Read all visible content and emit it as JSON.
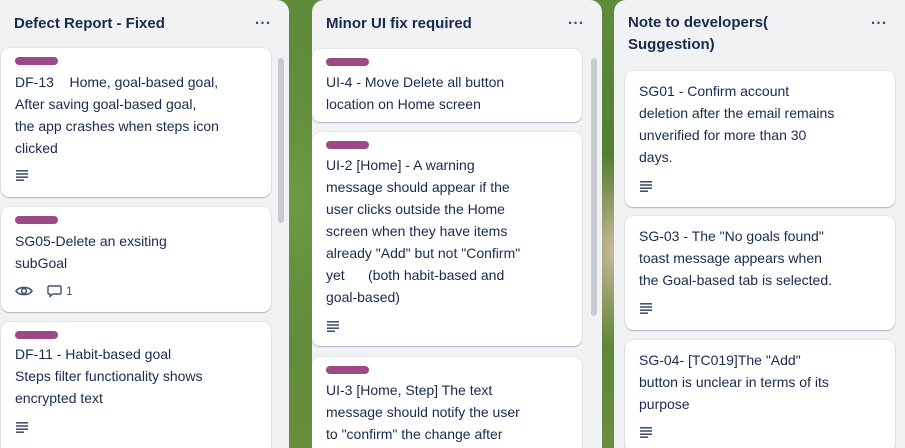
{
  "columns": [
    {
      "title": "Defect Report - Fixed",
      "menu_label": "...",
      "cards": [
        {
          "text": "DF-13    Home, goal-based goal,\nAfter saving goal-based goal,\nthe app crashes when steps icon\nclicked",
          "has_label": true,
          "badges": [
            "description-icon"
          ]
        },
        {
          "text": "SG05-Delete an exsiting\nsubGoal",
          "has_label": true,
          "badges": [
            "watch-icon",
            "comment-icon"
          ],
          "comment_count": "1"
        },
        {
          "text": "DF-11 - Habit-based goal\nSteps filter functionality shows\nencrypted text",
          "has_label": true,
          "badges": [
            "description-icon"
          ]
        }
      ]
    },
    {
      "title": "Minor UI fix required",
      "menu_label": "...",
      "cards": [
        {
          "text": "UI-4 - Move Delete all button\nlocation on Home screen",
          "has_label": true,
          "badges": []
        },
        {
          "text": "UI-2 [Home] - A warning\nmessage should appear if the\nuser clicks outside the Home\nscreen when they have items\nalready \"Add\" but not \"Confirm\"\nyet      (both habit-based and\ngoal-based)",
          "has_label": true,
          "badges": [
            "description-icon"
          ]
        },
        {
          "text": "UI-3 [Home, Step] The text\nmessage should notify the user\nto \"confirm\" the change after",
          "has_label": true,
          "badges": []
        }
      ]
    },
    {
      "title": "Note to developers(\nSuggestion)",
      "menu_label": "...",
      "cards": [
        {
          "text": "SG01 - Confirm account\ndeletion after the email remains\nunverified for more than 30\ndays.",
          "has_label": false,
          "badges": [
            "description-icon"
          ]
        },
        {
          "text": "SG-03 - The \"No goals found\"\ntoast message appears when\nthe Goal-based tab is selected.",
          "has_label": false,
          "badges": [
            "description-icon"
          ]
        },
        {
          "text": "SG-04- [TC019]The \"Add\"\nbutton is unclear in terms of its\npurpose",
          "has_label": false,
          "badges": [
            "description-icon"
          ]
        }
      ]
    }
  ],
  "colors": {
    "label": "#9c4a86",
    "list_bg": "#f1f2f4",
    "card_bg": "#ffffff",
    "text": "#172b4d",
    "muted": "#44546f"
  }
}
